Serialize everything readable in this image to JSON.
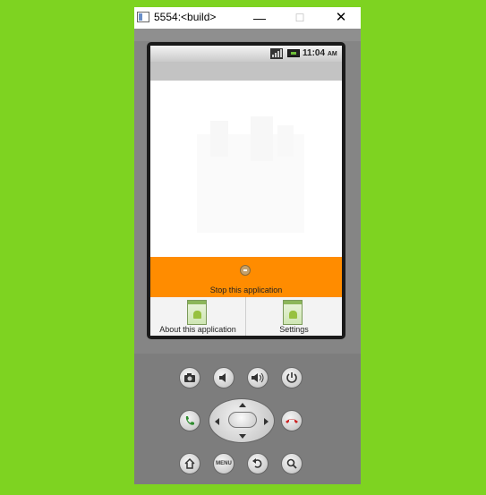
{
  "window": {
    "title": "5554:<build>",
    "minimize_symbol": "—",
    "maximize_symbol": "☐",
    "close_symbol": "✕"
  },
  "statusbar": {
    "time": "11:04",
    "ampm": "AM",
    "icons": [
      "signal-icon",
      "battery-icon"
    ]
  },
  "stop_panel": {
    "label": "Stop this application",
    "icon": "stop-icon"
  },
  "menu": {
    "items": [
      {
        "label": "About this application",
        "icon": "android-app-icon"
      },
      {
        "label": "Settings",
        "icon": "android-app-icon"
      }
    ]
  },
  "hardware_buttons": {
    "row1": [
      "camera-icon",
      "volume-down-icon",
      "volume-up-icon",
      "power-icon"
    ],
    "row2": [
      "call-icon",
      "dpad",
      "end-call-icon"
    ],
    "row3": [
      "home-icon",
      "menu-button",
      "back-icon",
      "search-icon"
    ],
    "menu_label": "MENU"
  },
  "colors": {
    "background": "#7ed321",
    "accent_orange": "#ff8c00",
    "call_green": "#2e8b2e",
    "end_call_red": "#cc2222"
  }
}
